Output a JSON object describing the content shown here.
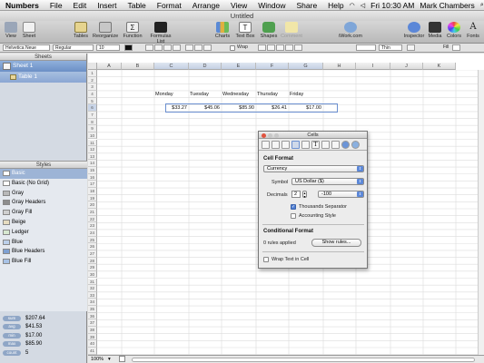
{
  "menubar": {
    "apple": "",
    "items": [
      "Numbers",
      "File",
      "Edit",
      "Insert",
      "Table",
      "Format",
      "Arrange",
      "View",
      "Window",
      "Share",
      "Help"
    ],
    "clock": "Fri 10:30 AM",
    "user": "Mark Chambers"
  },
  "window": {
    "title": "Untitled"
  },
  "toolbar": {
    "view": "View",
    "sheet": "Sheet",
    "tables": "Tables",
    "reorganize": "Reorganize",
    "function": "Function",
    "formulas_list": "Formulas List",
    "charts": "Charts",
    "text_box": "Text Box",
    "shapes": "Shapes",
    "comment": "Comment",
    "iwork": "iWork.com",
    "inspector": "Inspector",
    "media": "Media",
    "colors": "Colors",
    "fonts": "Fonts"
  },
  "formatbar": {
    "font_family": "Helvetica Neue",
    "font_style": "Regular",
    "font_size": "10",
    "wrap": "Wrap",
    "stroke": "Thin",
    "fill": "Fill"
  },
  "sidebar": {
    "header": "Sheets",
    "sheets": [
      {
        "label": "Sheet 1"
      }
    ],
    "tables": [
      {
        "label": "Table 1"
      }
    ]
  },
  "styles": {
    "header": "Styles",
    "items": [
      {
        "label": "Basic",
        "swatch": "#ffffff"
      },
      {
        "label": "Basic (No Grid)",
        "swatch": "#ffffff"
      },
      {
        "label": "Gray",
        "swatch": "#b9b9b9"
      },
      {
        "label": "Gray Headers",
        "swatch": "#8e8e8e"
      },
      {
        "label": "Gray Fill",
        "swatch": "#cfcfcf"
      },
      {
        "label": "Beige",
        "swatch": "#e6dcc0"
      },
      {
        "label": "Ledger",
        "swatch": "#d7e8d0"
      },
      {
        "label": "Blue",
        "swatch": "#bcd0ea"
      },
      {
        "label": "Blue Headers",
        "swatch": "#7ea0d2"
      },
      {
        "label": "Blue Fill",
        "swatch": "#a8c2e6"
      }
    ]
  },
  "summary": [
    {
      "label": "sum",
      "value": "$207.64"
    },
    {
      "label": "avg",
      "value": "$41.53"
    },
    {
      "label": "min",
      "value": "$17.00"
    },
    {
      "label": "max",
      "value": "$85.90"
    },
    {
      "label": "count",
      "value": "5"
    }
  ],
  "spreadsheet": {
    "columns": [
      "A",
      "B",
      "C",
      "D",
      "E",
      "F",
      "G",
      "H",
      "I",
      "J",
      "K"
    ],
    "rows": [
      "1",
      "2",
      "3",
      "4",
      "5",
      "6",
      "7",
      "8",
      "9",
      "10",
      "11",
      "12",
      "13",
      "14",
      "15",
      "16",
      "17",
      "18",
      "19",
      "20",
      "21",
      "22",
      "23",
      "24",
      "25",
      "26",
      "27",
      "28",
      "29",
      "30",
      "31",
      "32",
      "33",
      "34",
      "35",
      "36",
      "37",
      "38",
      "39",
      "40",
      "41"
    ],
    "headers": [
      "Monday",
      "Tuesday",
      "Wednesday",
      "Thursday",
      "Friday"
    ],
    "values": [
      "$33.27",
      "$45.06",
      "$85.90",
      "$26.41",
      "$17.00"
    ]
  },
  "statusbar": {
    "zoom": "100%"
  },
  "inspector": {
    "title": "Cells",
    "cell_format_heading": "Cell Format",
    "format_value": "Currency",
    "symbol_label": "Symbol",
    "symbol_value": "US Dollar ($)",
    "decimals_label": "Decimals",
    "decimals_value": "2",
    "negative_value": "-100",
    "thousands_label": "Thousands Separator",
    "accounting_label": "Accounting Style",
    "conditional_heading": "Conditional Format",
    "rules_text": "0 rules applied",
    "show_rules_label": "Show rules...",
    "wrap_label": "Wrap Text in Cell"
  }
}
